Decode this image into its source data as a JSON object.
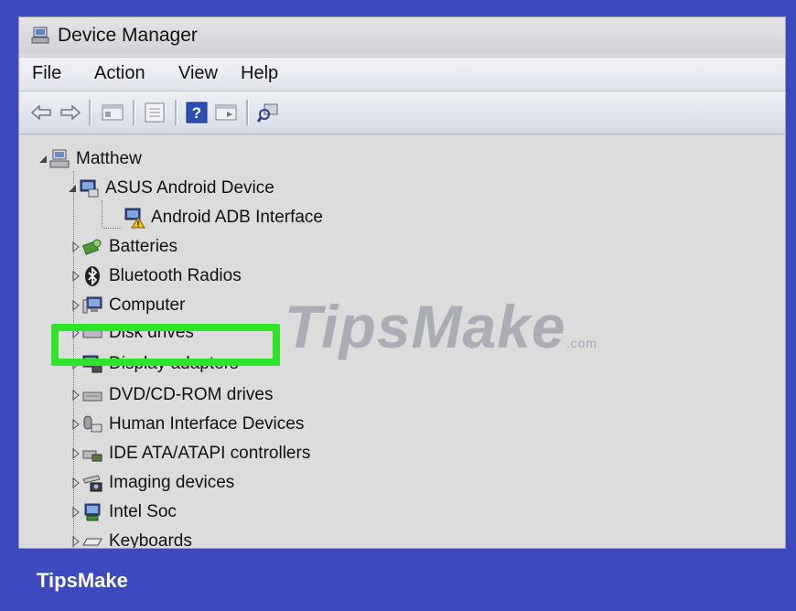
{
  "window": {
    "title": "Device Manager"
  },
  "menu": [
    {
      "label": "File"
    },
    {
      "label": "Action"
    },
    {
      "label": "View"
    },
    {
      "label": "Help"
    }
  ],
  "toolbar": {
    "buttons": [
      "back-arrow-icon",
      "forward-arrow-icon",
      "show-hide-tree-icon",
      "properties-icon",
      "help-icon",
      "run-icon",
      "scan-hardware-icon"
    ]
  },
  "tree": {
    "root": "Matthew",
    "items": [
      {
        "label": "ASUS Android Device",
        "expanded": true,
        "icon": "android-device-icon"
      },
      {
        "label": "Android ADB Interface",
        "icon": "adb-warning-icon"
      },
      {
        "label": "Batteries",
        "icon": "battery-icon"
      },
      {
        "label": "Bluetooth Radios",
        "icon": "bluetooth-icon"
      },
      {
        "label": "Computer",
        "icon": "computer-icon"
      },
      {
        "label": "Disk drives",
        "icon": "disk-drive-icon"
      },
      {
        "label": "Display adapters",
        "icon": "display-adapter-icon",
        "highlighted": true
      },
      {
        "label": "DVD/CD-ROM drives",
        "icon": "dvd-drive-icon"
      },
      {
        "label": "Human Interface Devices",
        "icon": "hid-icon"
      },
      {
        "label": "IDE ATA/ATAPI controllers",
        "icon": "ide-controller-icon"
      },
      {
        "label": "Imaging devices",
        "icon": "imaging-device-icon"
      },
      {
        "label": "Intel Soc",
        "icon": "intel-soc-icon"
      },
      {
        "label": "Keyboards",
        "icon": "keyboard-icon"
      }
    ]
  },
  "watermark": {
    "text": "TipsMake",
    "suffix": ".com"
  },
  "footer": {
    "brand": "TipsMake"
  },
  "colors": {
    "border": "#3d49bf",
    "highlight": "#2ee42a"
  }
}
